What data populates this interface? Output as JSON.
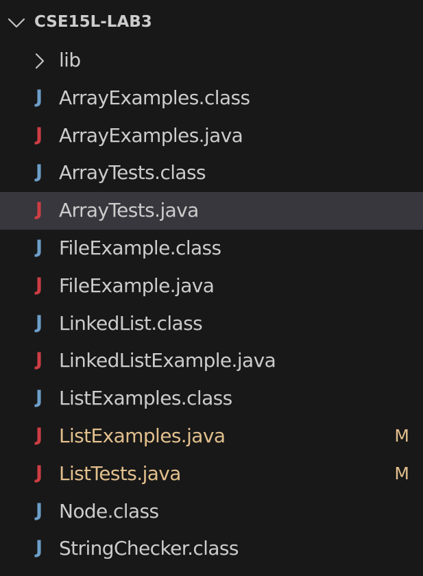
{
  "explorer": {
    "folder": {
      "name": "CSE15L-LAB3",
      "expanded": true,
      "chevron_icon": "chevron-down-icon"
    },
    "items": [
      {
        "kind": "folder",
        "label": "lib",
        "icon": "chevron-right-icon"
      },
      {
        "kind": "file",
        "label": "ArrayExamples.class",
        "icon": "java-class-icon",
        "badge": ""
      },
      {
        "kind": "file",
        "label": "ArrayExamples.java",
        "icon": "java-source-icon",
        "badge": ""
      },
      {
        "kind": "file",
        "label": "ArrayTests.class",
        "icon": "java-class-icon",
        "badge": ""
      },
      {
        "kind": "file",
        "label": "ArrayTests.java",
        "icon": "java-source-icon",
        "badge": "",
        "selected": true
      },
      {
        "kind": "file",
        "label": "FileExample.class",
        "icon": "java-class-icon",
        "badge": ""
      },
      {
        "kind": "file",
        "label": "FileExample.java",
        "icon": "java-source-icon",
        "badge": ""
      },
      {
        "kind": "file",
        "label": "LinkedList.class",
        "icon": "java-class-icon",
        "badge": ""
      },
      {
        "kind": "file",
        "label": "LinkedListExample.java",
        "icon": "java-source-icon",
        "badge": ""
      },
      {
        "kind": "file",
        "label": "ListExamples.class",
        "icon": "java-class-icon",
        "badge": ""
      },
      {
        "kind": "file",
        "label": "ListExamples.java",
        "icon": "java-source-icon",
        "badge": "M",
        "modified": true
      },
      {
        "kind": "file",
        "label": "ListTests.java",
        "icon": "java-source-icon",
        "badge": "M",
        "modified": true
      },
      {
        "kind": "file",
        "label": "Node.class",
        "icon": "java-class-icon",
        "badge": ""
      },
      {
        "kind": "file",
        "label": "StringChecker.class",
        "icon": "java-class-icon",
        "badge": ""
      }
    ],
    "icon_glyph": "J"
  },
  "colors": {
    "background": "#181818",
    "selected_row": "#37373d",
    "text": "#cccccc",
    "modified_text": "#e2c08d",
    "java_class_icon": "#6d9ec9",
    "java_source_icon": "#cc3e44",
    "chevron": "#c5c5c5"
  }
}
